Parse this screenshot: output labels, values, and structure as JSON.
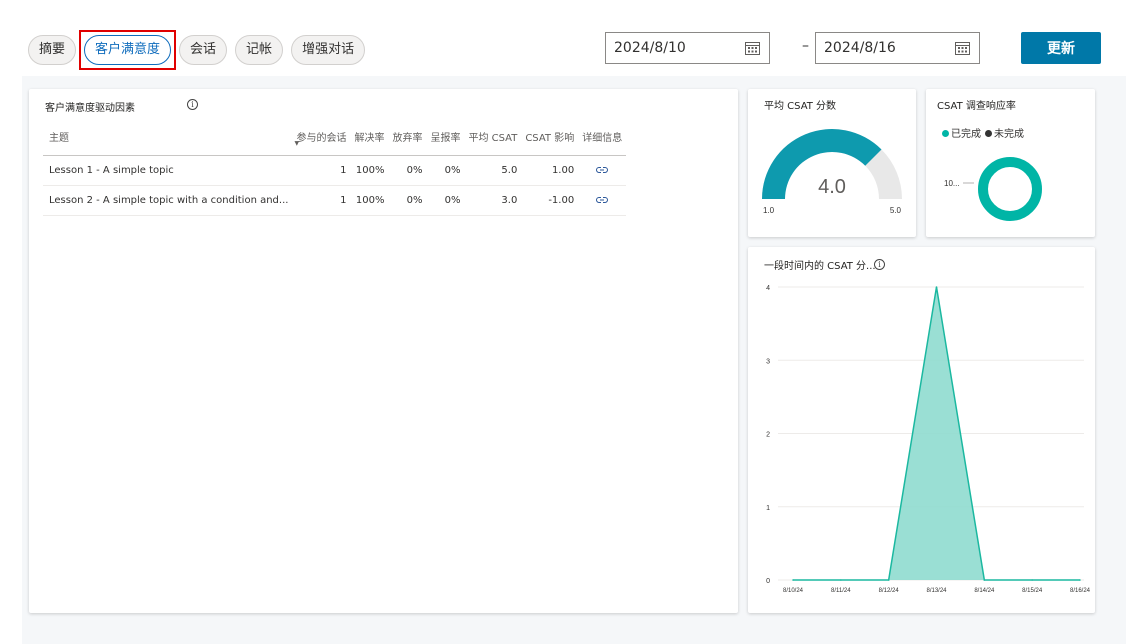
{
  "tabs": [
    {
      "label": "摘要"
    },
    {
      "label": "客户满意度"
    },
    {
      "label": "会话"
    },
    {
      "label": "记帐"
    },
    {
      "label": "增强对话"
    }
  ],
  "date_range": {
    "start": "2024/8/10",
    "end": "2024/8/16",
    "separator": "–"
  },
  "refresh_label": "更新",
  "drivers": {
    "title": "客户满意度驱动因素",
    "columns": [
      "主题",
      "参与的会话",
      "解决率",
      "放弃率",
      "呈报率",
      "平均 CSAT",
      "CSAT 影响",
      "详细信息"
    ],
    "rows": [
      {
        "topic": "Lesson 1 - A simple topic",
        "sessions": "1",
        "resolution": "100%",
        "abandon": "0%",
        "escalation": "0%",
        "avg_csat": "5.0",
        "impact": "1.00"
      },
      {
        "topic": "Lesson 2 - A simple topic with a condition and...",
        "sessions": "1",
        "resolution": "100%",
        "abandon": "0%",
        "escalation": "0%",
        "avg_csat": "3.0",
        "impact": "-1.00"
      }
    ]
  },
  "avg_csat": {
    "title": "平均 CSAT 分数",
    "value": "4.0",
    "min": "1.0",
    "max": "5.0",
    "value_num": 4.0,
    "min_num": 1.0,
    "max_num": 5.0,
    "fill_color": "#0e9aae",
    "track_color": "#e8e8e8"
  },
  "survey": {
    "title": "CSAT 调查响应率",
    "legend": [
      {
        "label": "已完成",
        "color": "#00b5a6"
      },
      {
        "label": "未完成",
        "color": "#333333"
      }
    ],
    "donut_label": "10...",
    "completed_color": "#00b5a6"
  },
  "trend": {
    "title": "一段时间内的 CSAT 分...",
    "accent": "#1bb8a0"
  },
  "chart_data": {
    "type": "area",
    "title": "一段时间内的 CSAT 分...",
    "categories": [
      "8/10/24",
      "8/11/24",
      "8/12/24",
      "8/13/24",
      "8/14/24",
      "8/15/24",
      "8/16/24"
    ],
    "values": [
      0,
      0,
      0,
      4,
      0,
      0,
      0
    ],
    "yticks": [
      "0",
      "1",
      "2",
      "3",
      "4"
    ],
    "ylim": [
      0,
      4
    ],
    "grid": true
  }
}
